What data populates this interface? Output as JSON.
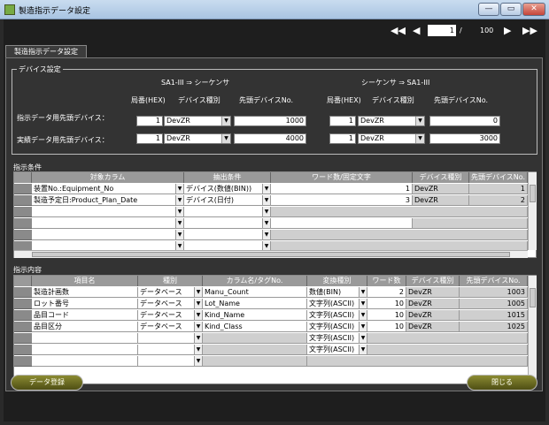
{
  "window": {
    "title": "製造指示データ設定",
    "min": "—",
    "max": "▭",
    "close": "✕"
  },
  "pager": {
    "first": "◀◀",
    "prev": "◀",
    "current": "1",
    "sep": "/",
    "total": "100",
    "next": "▶",
    "last": "▶▶"
  },
  "tab": "製造指示データ設定",
  "device": {
    "group": "デバイス設定",
    "left_dir": "SA1-III ⇒ シーケンサ",
    "right_dir": "シーケンサ ⇒ SA1-III",
    "col_station": "局番(HEX)",
    "col_type": "デバイス種別",
    "col_start": "先頭デバイスNo.",
    "row1_label": "指示データ用先頭デバイス：",
    "row2_label": "実績データ用先頭デバイス：",
    "r1": {
      "ls": "1",
      "lt": "DevZR",
      "lstart": "1000",
      "rs": "1",
      "rt": "DevZR",
      "rstart": "0"
    },
    "r2": {
      "ls": "1",
      "lt": "DevZR",
      "lstart": "4000",
      "rs": "1",
      "rt": "DevZR",
      "rstart": "3000"
    }
  },
  "cond": {
    "group": "指示条件",
    "headers": [
      "対象カラム",
      "抽出条件",
      "ワード数/固定文字",
      "デバイス種別",
      "先頭デバイスNo."
    ],
    "rows": [
      {
        "col": "装置No.:Equipment_No",
        "ext": "デバイス(数値(BIN))",
        "word": "1",
        "type": "DevZR",
        "start": "1"
      },
      {
        "col": "製造予定日:Product_Plan_Date",
        "ext": "デバイス(日付)",
        "word": "3",
        "type": "DevZR",
        "start": "2"
      }
    ]
  },
  "content": {
    "group": "指示内容",
    "headers": [
      "項目名",
      "種別",
      "カラム名/タグNo.",
      "変換種別",
      "ワード数",
      "デバイス種別",
      "先頭デバイスNo."
    ],
    "rows": [
      {
        "name": "製造計画数",
        "kind": "データベース",
        "colname": "Manu_Count",
        "conv": "数値(BIN)",
        "word": "2",
        "type": "DevZR",
        "start": "1003"
      },
      {
        "name": "ロット番号",
        "kind": "データベース",
        "colname": "Lot_Name",
        "conv": "文字列(ASCII)",
        "word": "10",
        "type": "DevZR",
        "start": "1005"
      },
      {
        "name": "品目コード",
        "kind": "データベース",
        "colname": "Kind_Name",
        "conv": "文字列(ASCII)",
        "word": "10",
        "type": "DevZR",
        "start": "1015"
      },
      {
        "name": "品目区分",
        "kind": "データベース",
        "colname": "Kind_Class",
        "conv": "文字列(ASCII)",
        "word": "10",
        "type": "DevZR",
        "start": "1025"
      }
    ],
    "empty_conv": "文字列(ASCII)"
  },
  "buttons": {
    "register": "データ登録",
    "close": "閉じる"
  }
}
